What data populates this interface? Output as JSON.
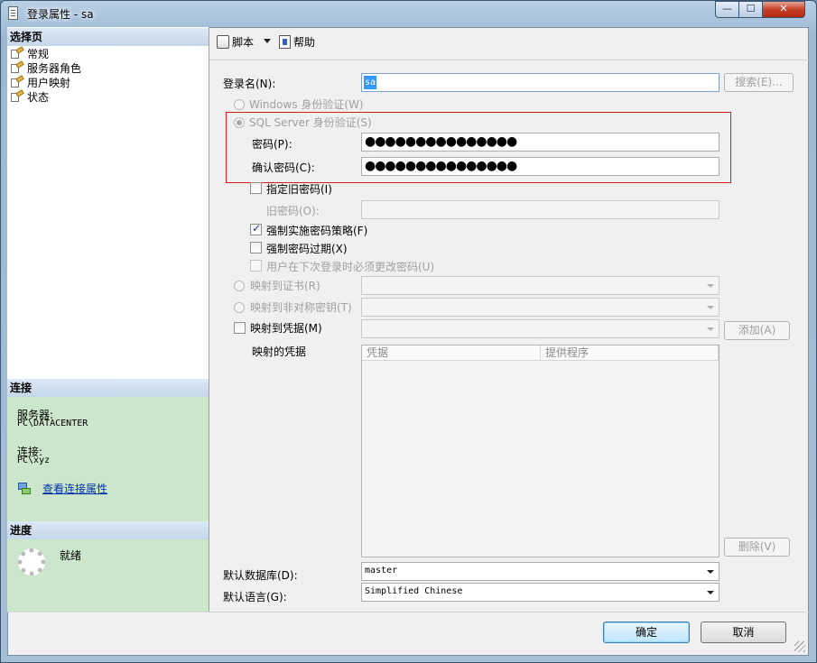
{
  "window": {
    "title": "登录属性 - sa",
    "minimize": "—",
    "maximize": "☐",
    "close": "✕"
  },
  "left": {
    "select_page_header": "选择页",
    "pages": [
      "常规",
      "服务器角色",
      "用户映射",
      "状态"
    ],
    "connection_header": "连接",
    "server_label": "服务器:",
    "server_value": "PC\\DATACENTER",
    "connection_label": "连接:",
    "connection_value": "PC\\xyz",
    "view_connection_link": "查看连接属性",
    "progress_header": "进度",
    "progress_status": "就绪"
  },
  "toolbar": {
    "script_label": "脚本",
    "help_label": "帮助"
  },
  "form": {
    "login_name_label": "登录名(N):",
    "login_name_value": "sa",
    "search_button": "搜索(E)...",
    "windows_auth_label": "Windows 身份验证(W)",
    "sql_auth_label": "SQL Server 身份验证(S)",
    "password_label": "密码(P):",
    "password_value": "●●●●●●●●●●●●●●●",
    "confirm_password_label": "确认密码(C):",
    "confirm_password_value": "●●●●●●●●●●●●●●●",
    "specify_old_password_label": "指定旧密码(I)",
    "old_password_label": "旧密码(O):",
    "enforce_policy_label": "强制实施密码策略(F)",
    "enforce_policy_checked": true,
    "enforce_expiration_label": "强制密码过期(X)",
    "enforce_expiration_checked": false,
    "must_change_label": "用户在下次登录时必须更改密码(U)",
    "map_cert_label": "映射到证书(R)",
    "map_asym_key_label": "映射到非对称密钥(T)",
    "map_credential_label": "映射到凭据(M)",
    "add_button": "添加(A)",
    "mapped_credentials_label": "映射的凭据",
    "grid_columns": [
      "凭据",
      "提供程序"
    ],
    "remove_button": "删除(V)",
    "default_db_label": "默认数据库(D):",
    "default_db_value": "master",
    "default_lang_label": "默认语言(G):",
    "default_lang_value": "Simplified Chinese"
  },
  "footer": {
    "ok_button": "确定",
    "cancel_button": "取消"
  }
}
